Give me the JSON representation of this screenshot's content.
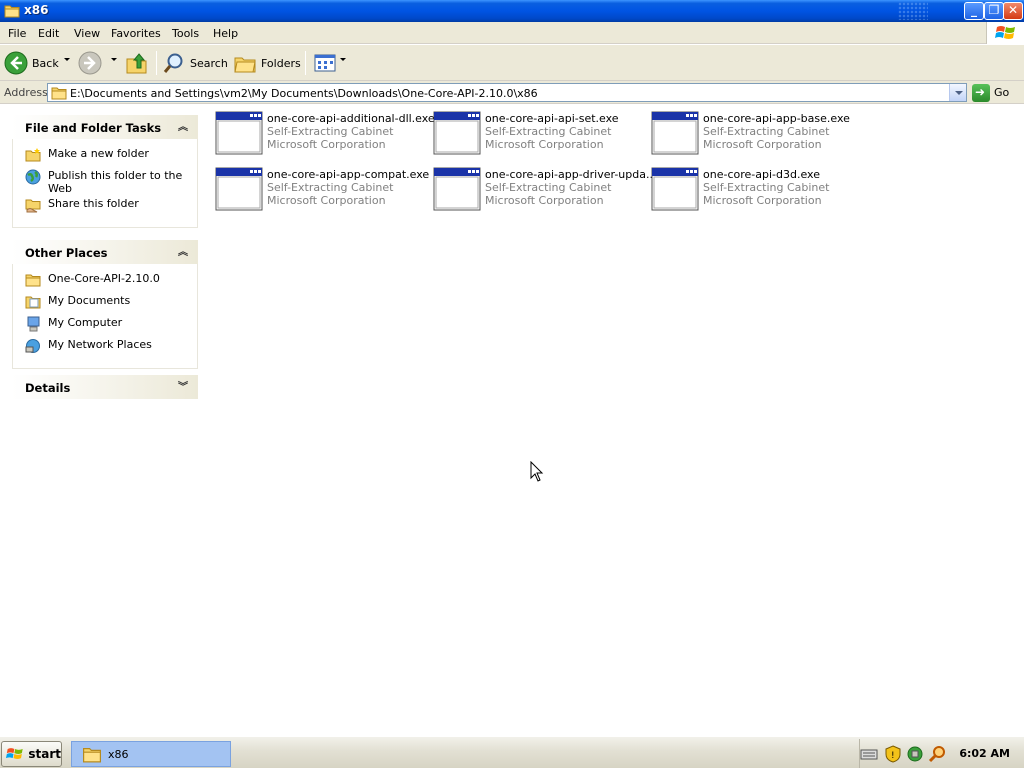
{
  "window": {
    "title": "x86"
  },
  "menubar": {
    "items": [
      "File",
      "Edit",
      "View",
      "Favorites",
      "Tools",
      "Help"
    ]
  },
  "toolbar": {
    "back_label": "Back",
    "search_label": "Search",
    "folders_label": "Folders"
  },
  "address": {
    "label": "Address",
    "value": "E:\\Documents and Settings\\vm2\\My Documents\\Downloads\\One-Core-API-2.10.0\\x86",
    "go_label": "Go"
  },
  "taskpane": {
    "file_tasks": {
      "title": "File and Folder Tasks",
      "links": [
        "Make a new folder",
        "Publish this folder to the Web",
        "Share this folder"
      ]
    },
    "other_places": {
      "title": "Other Places",
      "links": [
        "One-Core-API-2.10.0",
        "My Documents",
        "My Computer",
        "My Network Places"
      ]
    },
    "details": {
      "title": "Details"
    }
  },
  "files": [
    {
      "name": "one-core-api-additional-dll.exe",
      "type": "Self-Extracting Cabinet",
      "publisher": "Microsoft Corporation"
    },
    {
      "name": "one-core-api-api-set.exe",
      "type": "Self-Extracting Cabinet",
      "publisher": "Microsoft Corporation"
    },
    {
      "name": "one-core-api-app-base.exe",
      "type": "Self-Extracting Cabinet",
      "publisher": "Microsoft Corporation"
    },
    {
      "name": "one-core-api-app-compat.exe",
      "type": "Self-Extracting Cabinet",
      "publisher": "Microsoft Corporation"
    },
    {
      "name": "one-core-api-app-driver-upda...",
      "type": "Self-Extracting Cabinet",
      "publisher": "Microsoft Corporation"
    },
    {
      "name": "one-core-api-d3d.exe",
      "type": "Self-Extracting Cabinet",
      "publisher": "Microsoft Corporation"
    }
  ],
  "taskbar": {
    "start_label": "start",
    "task_label": "x86",
    "clock": "6:02 AM"
  },
  "colors": {
    "titlebar": "#0054e3",
    "taskpane_header": "#ece9d8",
    "selected_task": "#a3c3f2"
  }
}
